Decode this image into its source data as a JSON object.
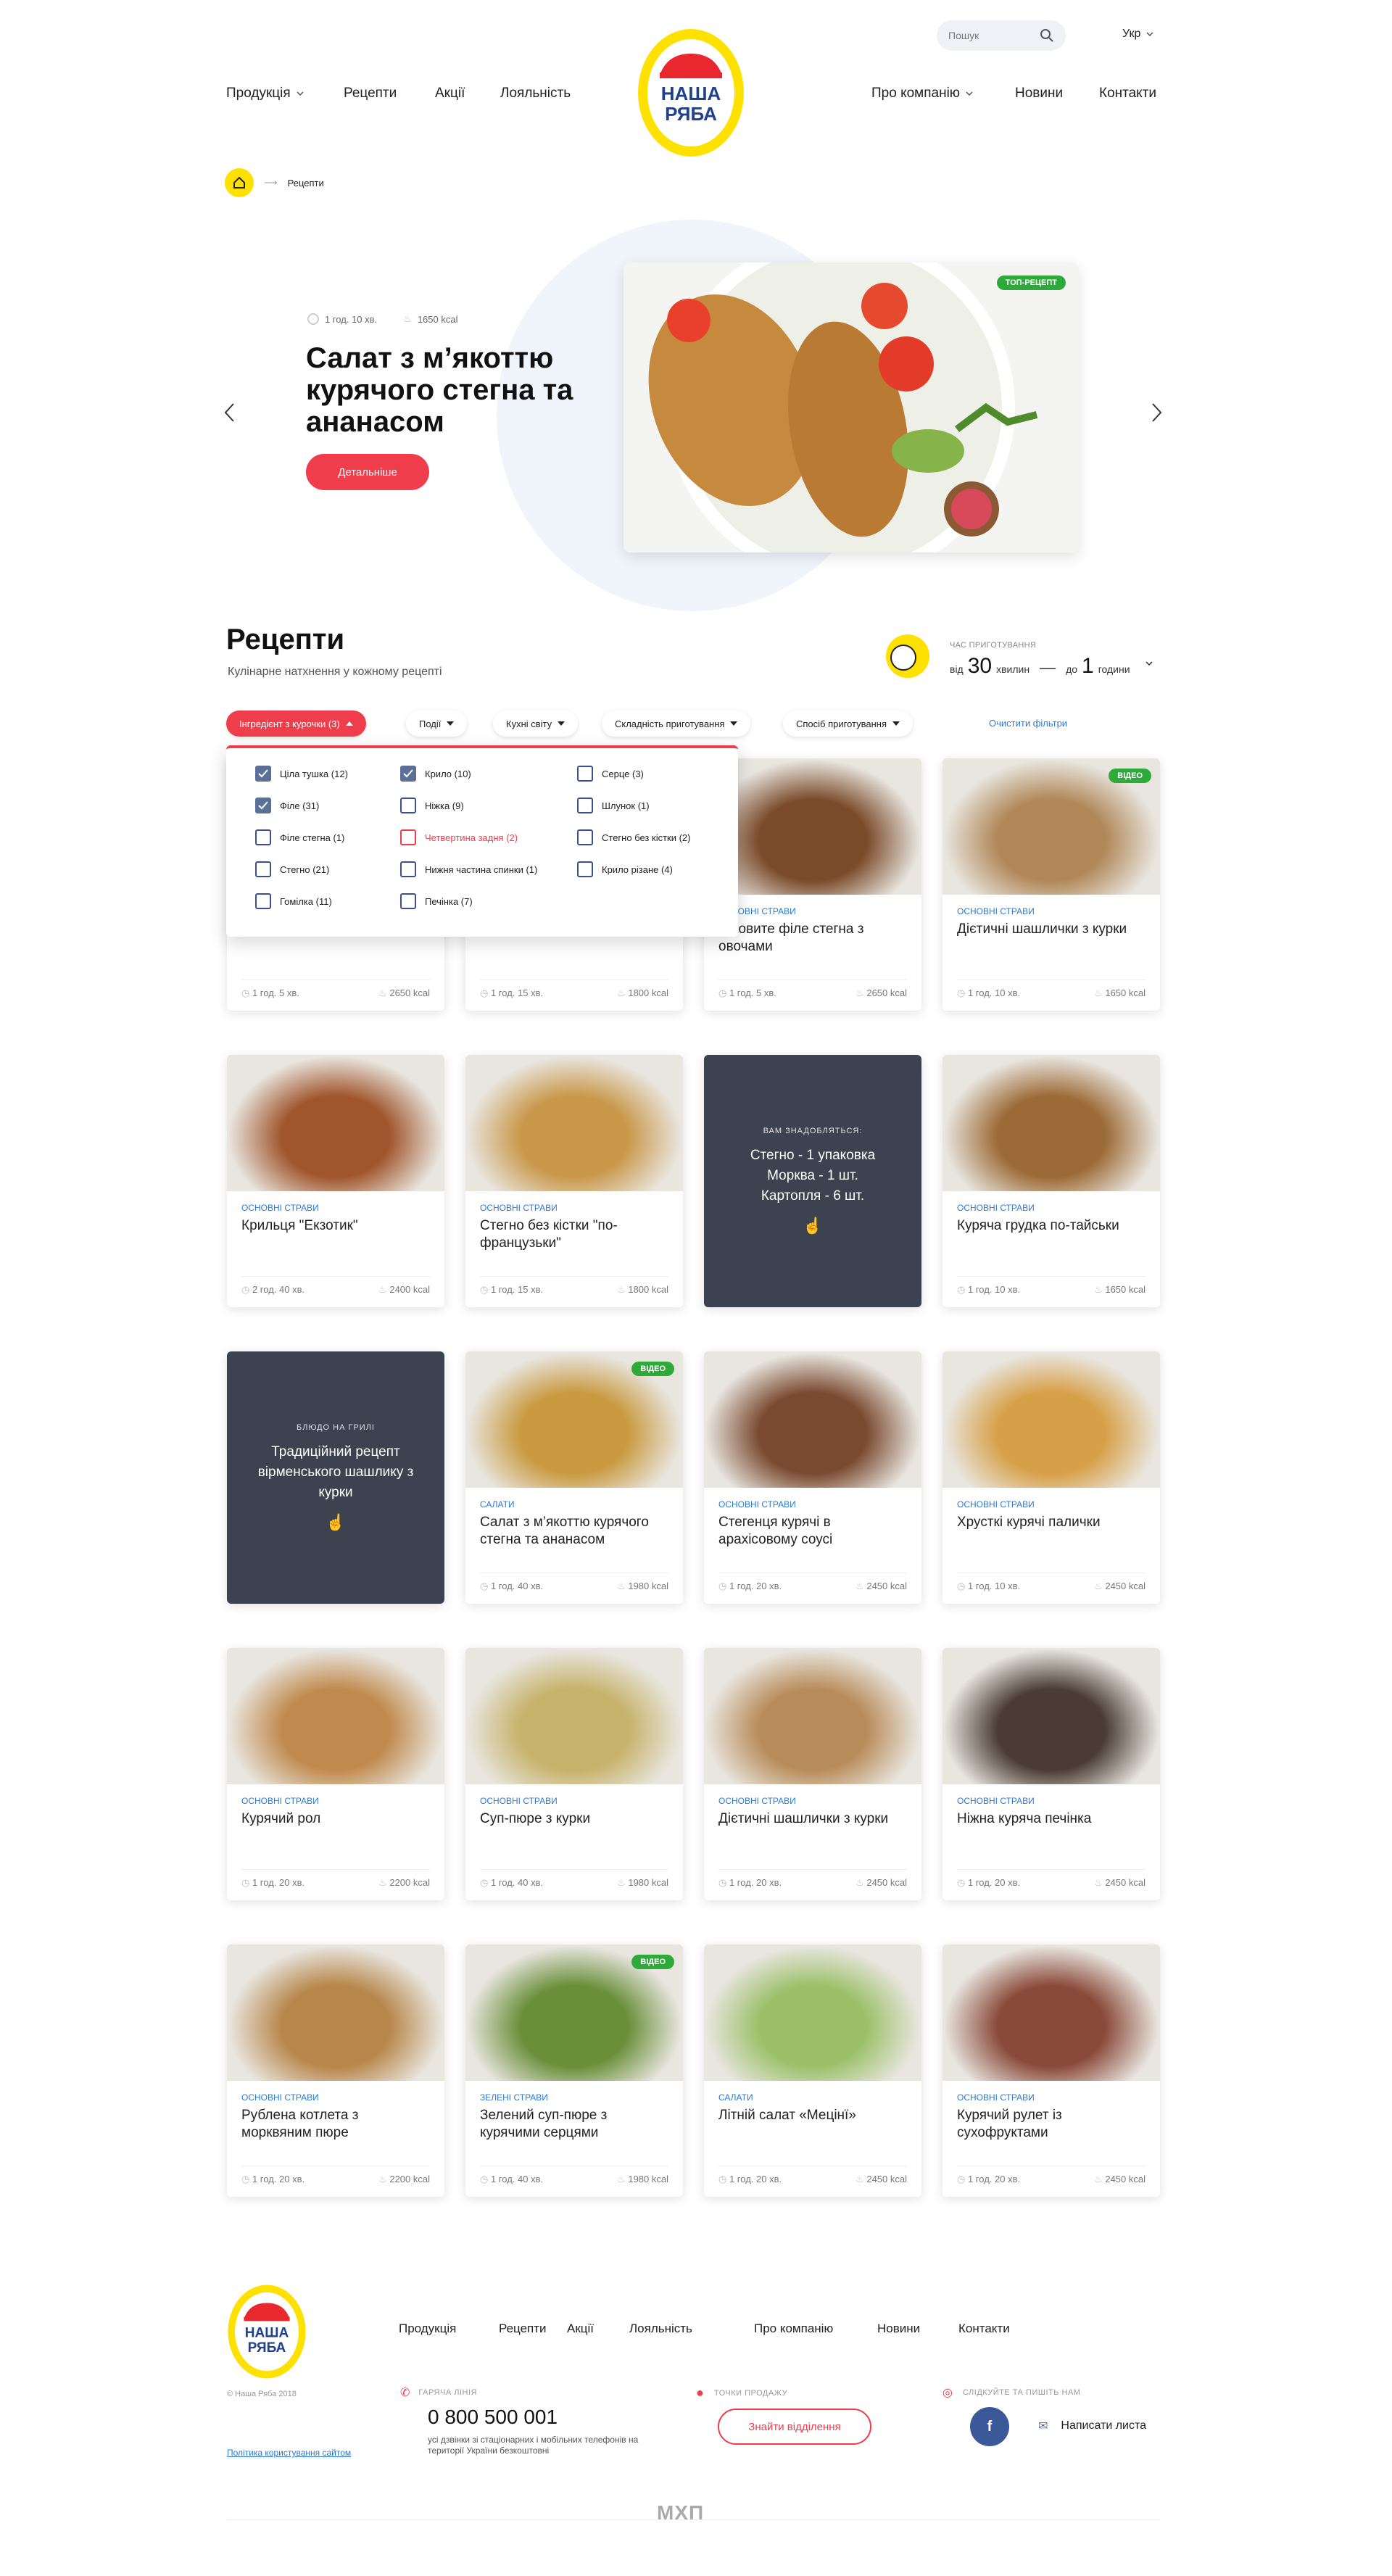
{
  "header": {
    "search_placeholder": "Пошук",
    "lang": "Укр",
    "nav_left": [
      "Продукція",
      "Рецепти",
      "Акції",
      "Лояльність"
    ],
    "nav_right": [
      "Про компанію",
      "Новини",
      "Контакти"
    ],
    "logo_text": [
      "НАША",
      "РЯБА"
    ]
  },
  "breadcrumb": {
    "current": "Рецепти"
  },
  "hero": {
    "time": "1 год. 10 хв.",
    "kcal": "1650 kcal",
    "title": "Салат з м’якоттю курячого стегна та ананасом",
    "button": "Детальніше",
    "badge": "ТОП-РЕЦЕПТ"
  },
  "recipes": {
    "title": "Рецепти",
    "subtitle": "Кулінарне натхнення у кожному рецепті",
    "time_label": "ЧАС ПРИГОТУВАННЯ",
    "time_from": "від",
    "time_from_val": "30",
    "time_from_unit": "хвилин",
    "time_dash": "—",
    "time_to": "до",
    "time_to_val": "1",
    "time_to_unit": "години"
  },
  "filters": [
    {
      "label": "Інгредієнт з курочки (3)",
      "active": true
    },
    {
      "label": "Події"
    },
    {
      "label": "Кухні світу"
    },
    {
      "label": "Складність приготування"
    },
    {
      "label": "Спосіб приготування"
    }
  ],
  "clear_filters": "Очистити фільтри",
  "dropdown": {
    "columns": [
      [
        {
          "label": "Ціла тушка (12)",
          "checked": true
        },
        {
          "label": "Філе (31)",
          "checked": true
        },
        {
          "label": "Філе стегна (1)"
        },
        {
          "label": "Стегно (21)"
        },
        {
          "label": "Гомілка (11)"
        }
      ],
      [
        {
          "label": "Крило (10)",
          "checked": true
        },
        {
          "label": "Ніжка (9)"
        },
        {
          "label": "Четвертина задня (2)",
          "hover": true
        },
        {
          "label": "Нижня частина спинки (1)"
        },
        {
          "label": "Печінка (7)"
        }
      ],
      [
        {
          "label": "Серце (3)"
        },
        {
          "label": "Шлунок (1)"
        },
        {
          "label": "Стегно без кістки (2)"
        },
        {
          "label": "Крило різане (4)"
        }
      ]
    ]
  },
  "video_badge": "ВІДЕО",
  "cards": [
    {
      "cat": "",
      "name": "",
      "time": "1 год. 5 хв.",
      "kcal": "2650 kcal",
      "hidden": true
    },
    {
      "cat": "",
      "name": "",
      "time": "1 год. 15 хв.",
      "kcal": "1800 kcal",
      "hidden": true
    },
    {
      "cat": "ОСНОВНІ СТРАВИ",
      "name": "…ковите філе стегна з овочами",
      "time": "1 год. 5 хв.",
      "kcal": "2650 kcal",
      "color": "#7a4a2a"
    },
    {
      "cat": "ОСНОВНІ СТРАВИ",
      "name": "Дієтичні шашлички з курки",
      "time": "1 год. 10 хв.",
      "kcal": "1650 kcal",
      "color": "#b08758",
      "video": true
    },
    {
      "cat": "ОСНОВНІ СТРАВИ",
      "name": "Крильця \"Екзотик\"",
      "time": "2 год. 40 хв.",
      "kcal": "2400 kcal",
      "color": "#a0552c"
    },
    {
      "cat": "ОСНОВНІ СТРАВИ",
      "name": "Стегно без кістки \"по-французьки\"",
      "time": "1 год. 15 хв.",
      "kcal": "1800 kcal",
      "color": "#c9984a"
    },
    {
      "dark": true,
      "small": "ВАМ ЗНАДОБЛЯТЬСЯ:",
      "big": [
        "Стегно - 1 упаковка",
        "Морква - 1 шт.",
        "Картопля - 6 шт."
      ]
    },
    {
      "cat": "ОСНОВНІ СТРАВИ",
      "name": "Куряча грудка по-тайськи",
      "time": "1 год. 10 хв.",
      "kcal": "1650 kcal",
      "color": "#9c6a36"
    },
    {
      "dark": true,
      "small": "БЛЮДО НА ГРИЛІ",
      "big": [
        "Традиційний рецепт вірменського шашлику з курки"
      ]
    },
    {
      "cat": "САЛАТИ",
      "name": "Салат з м’якоттю курячого стегна та ананасом",
      "time": "1 год. 40 хв.",
      "kcal": "1980 kcal",
      "color": "#c99a40",
      "video": true
    },
    {
      "cat": "ОСНОВНІ СТРАВИ",
      "name": "Стегенця курячі в арахісовому соусі",
      "time": "1 год. 20 хв.",
      "kcal": "2450 kcal",
      "color": "#7a4a30"
    },
    {
      "cat": "ОСНОВНІ СТРАВИ",
      "name": "Хрусткі курячі палички",
      "time": "1 год. 10 хв.",
      "kcal": "2450 kcal",
      "color": "#d7a048"
    },
    {
      "cat": "ОСНОВНІ СТРАВИ",
      "name": "Курячий рол",
      "time": "1 год. 20 хв.",
      "kcal": "2200 kcal",
      "color": "#c08a4e"
    },
    {
      "cat": "ОСНОВНІ СТРАВИ",
      "name": "Суп-пюре з курки",
      "time": "1 год. 40 хв.",
      "kcal": "1980 kcal",
      "color": "#c6b26a"
    },
    {
      "cat": "ОСНОВНІ СТРАВИ",
      "name": "Дієтичні шашлички з курки",
      "time": "1 год. 20 хв.",
      "kcal": "2450 kcal",
      "color": "#b88c5a"
    },
    {
      "cat": "ОСНОВНІ СТРАВИ",
      "name": "Ніжна куряча печінка",
      "time": "1 год. 20 хв.",
      "kcal": "2450 kcal",
      "color": "#4a3c34"
    },
    {
      "cat": "ОСНОВНІ СТРАВИ",
      "name": "Рублена котлета з морквяним пюре",
      "time": "1 год. 20 хв.",
      "kcal": "2200 kcal",
      "color": "#b7864a"
    },
    {
      "cat": "ЗЕЛЕНІ СТРАВИ",
      "name": "Зелений суп-пюре з курячими серцями",
      "time": "1 год. 40 хв.",
      "kcal": "1980 kcal",
      "color": "#6a8f3a",
      "video": true
    },
    {
      "cat": "САЛАТИ",
      "name": "Літній салат «Мецінї»",
      "time": "1 год. 20 хв.",
      "kcal": "2450 kcal",
      "color": "#9cc06a"
    },
    {
      "cat": "ОСНОВНІ СТРАВИ",
      "name": "Курячий рулет із сухофруктами",
      "time": "1 год. 20 хв.",
      "kcal": "2450 kcal",
      "color": "#8a4a3a"
    }
  ],
  "footer": {
    "nav": [
      "Продукція",
      "Рецепти",
      "Акції",
      "Лояльність",
      "Про компанію",
      "Новини",
      "Контакти"
    ],
    "copyright": "© Наша Ряба 2018",
    "policy": "Політика користування сайтом",
    "hotline_label": "ГАРЯЧА ЛІНІЯ",
    "phone": "0 800 500 001",
    "phone_note": "усі дзвінки зі стаціонарних і мобільних телефонів на території України безкоштовні",
    "points_label": "ТОЧКИ ПРОДАЖУ",
    "points_button": "Знайти відділення",
    "social_label": "СЛІДКУЙТЕ ТА ПИШІТЬ НАМ",
    "fb": "f",
    "write": "Написати листа",
    "maker": "МХП"
  },
  "colors": {
    "accent": "#ef3d4b",
    "yellow": "#ffe100",
    "link": "#2d7ad6",
    "brand_blue": "#1f3f8f"
  }
}
